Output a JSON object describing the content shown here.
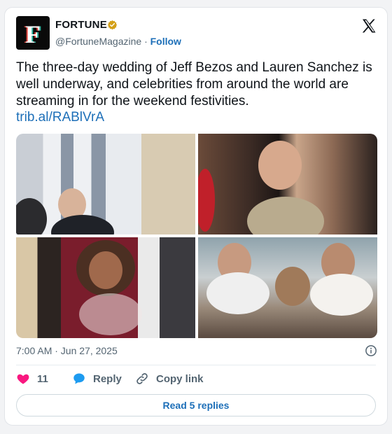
{
  "account": {
    "name": "FORTUNE",
    "handle": "@FortuneMagazine",
    "separator": "·",
    "follow_label": "Follow",
    "avatar_letter": "F"
  },
  "tweet": {
    "text": "The three-day wedding of Jeff Bezos and Lauren Sanchez is well underway, and celebrities from around the world are streaming in for the weekend festivities.",
    "link": "trib.al/RABlVrA",
    "timestamp": "7:00 AM · Jun 27, 2025"
  },
  "media": {
    "photos": [
      "photo-1",
      "photo-2",
      "photo-3",
      "photo-4"
    ]
  },
  "actions": {
    "like_count": "11",
    "reply_label": "Reply",
    "copy_link_label": "Copy link"
  },
  "footer": {
    "read_replies_label": "Read 5 replies"
  },
  "icons": [
    "x-logo-icon",
    "verified-badge-icon",
    "info-icon",
    "heart-icon",
    "reply-bubble-icon",
    "link-icon"
  ],
  "colors": {
    "link": "#1d6fb8",
    "like": "#f91880",
    "reply": "#1d9bf0",
    "verified": "#d4a017"
  }
}
